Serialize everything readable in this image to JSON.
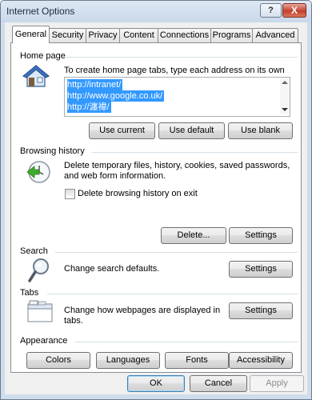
{
  "window": {
    "title": "Internet Options"
  },
  "titlebar": {
    "help_glyph": "?",
    "close_glyph": "X"
  },
  "tabs": [
    {
      "label": "General"
    },
    {
      "label": "Security"
    },
    {
      "label": "Privacy"
    },
    {
      "label": "Content"
    },
    {
      "label": "Connections"
    },
    {
      "label": "Programs"
    },
    {
      "label": "Advanced"
    }
  ],
  "home_page": {
    "section_label": "Home page",
    "description": "To create home page tabs, type each address on its own line.",
    "lines": [
      "http://intranet/",
      "http://www.google.co.uk/",
      "http://瀍禕/"
    ],
    "use_current": "Use current",
    "use_default": "Use default",
    "use_blank": "Use blank"
  },
  "browsing_history": {
    "section_label": "Browsing history",
    "description_1": "Delete temporary files, history, cookies, saved passwords,",
    "description_2": "and web form information.",
    "checkbox_label": "Delete browsing history on exit",
    "delete_button": "Delete...",
    "settings_button": "Settings"
  },
  "search": {
    "section_label": "Search",
    "description": "Change search defaults.",
    "settings_button": "Settings"
  },
  "tabs_section": {
    "section_label": "Tabs",
    "description_1": "Change how webpages are displayed in",
    "description_2": "tabs.",
    "settings_button": "Settings"
  },
  "appearance": {
    "section_label": "Appearance",
    "colors": "Colors",
    "languages": "Languages",
    "fonts": "Fonts",
    "accessibility": "Accessibility"
  },
  "footer": {
    "ok": "OK",
    "cancel": "Cancel",
    "apply": "Apply"
  }
}
